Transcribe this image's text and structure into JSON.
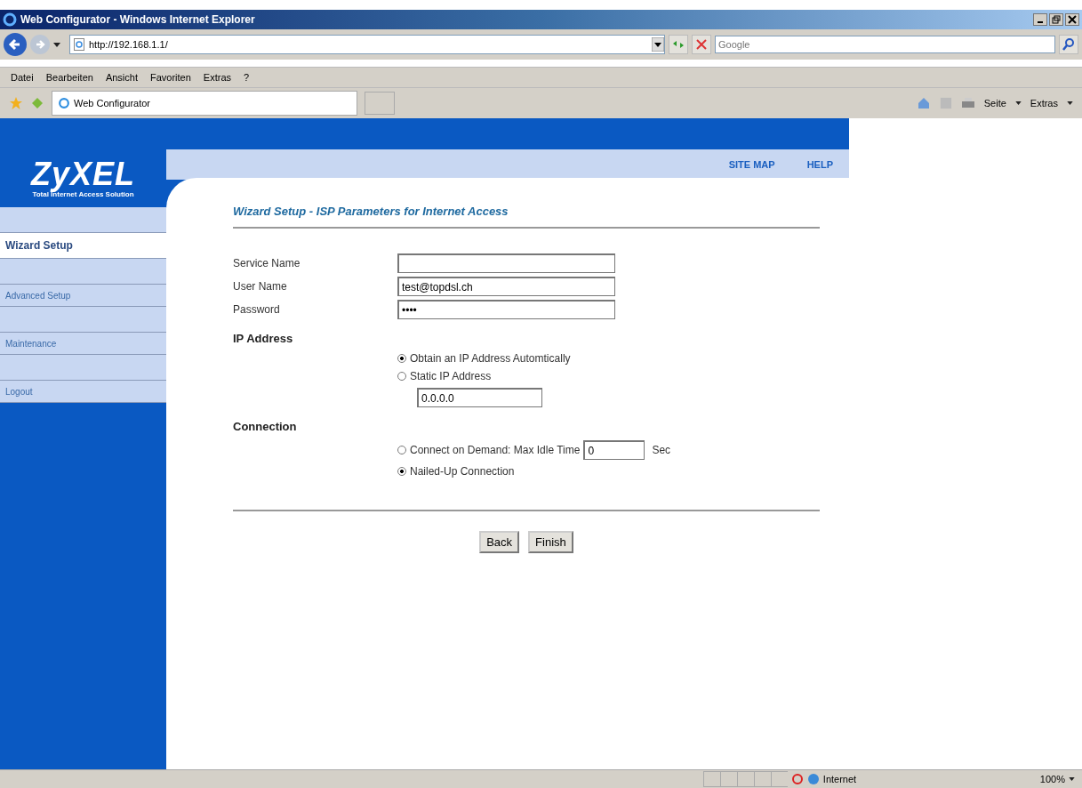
{
  "window": {
    "title": "Web Configurator - Windows Internet Explorer"
  },
  "address_bar": {
    "url": "http://192.168.1.1/"
  },
  "search": {
    "placeholder": "Google"
  },
  "menu": [
    "Datei",
    "Bearbeiten",
    "Ansicht",
    "Favoriten",
    "Extras",
    "?"
  ],
  "tab": {
    "title": "Web Configurator"
  },
  "command_bar": [
    "Seite",
    "Extras"
  ],
  "header": {
    "logo": "ZyXEL",
    "tagline": "Total Internet Access Solution",
    "links": [
      "SITE MAP",
      "HELP"
    ]
  },
  "sidebar": {
    "items": [
      {
        "label": "Wizard Setup",
        "selected": true
      },
      {
        "label": "Advanced Setup",
        "selected": false
      },
      {
        "label": "Maintenance",
        "selected": false
      },
      {
        "label": "Logout",
        "selected": false
      }
    ]
  },
  "page_title": "Wizard Setup - ISP Parameters for Internet Access",
  "fields": [
    {
      "label": "Service Name"
    },
    {
      "label": "User Name",
      "value": "test@topdsl.ch"
    },
    {
      "label": "Password",
      "value": "••••"
    }
  ],
  "ip_address": {
    "heading": "IP Address",
    "options": [
      {
        "label": "Obtain an IP Address Automtically",
        "selected": true
      },
      {
        "label": "Static IP Address",
        "selected": false
      }
    ],
    "static_value": "0.0.0.0"
  },
  "connection": {
    "heading": "Connection",
    "options": [
      {
        "label": "Connect on Demand: Max Idle Time",
        "selected": false,
        "idle_value": "0",
        "unit": "Sec"
      },
      {
        "label": "Nailed-Up Connection",
        "selected": true
      }
    ]
  },
  "buttons": [
    "Back",
    "Finish"
  ],
  "status_bar": {
    "zone": "Internet",
    "zoom": "100%"
  }
}
